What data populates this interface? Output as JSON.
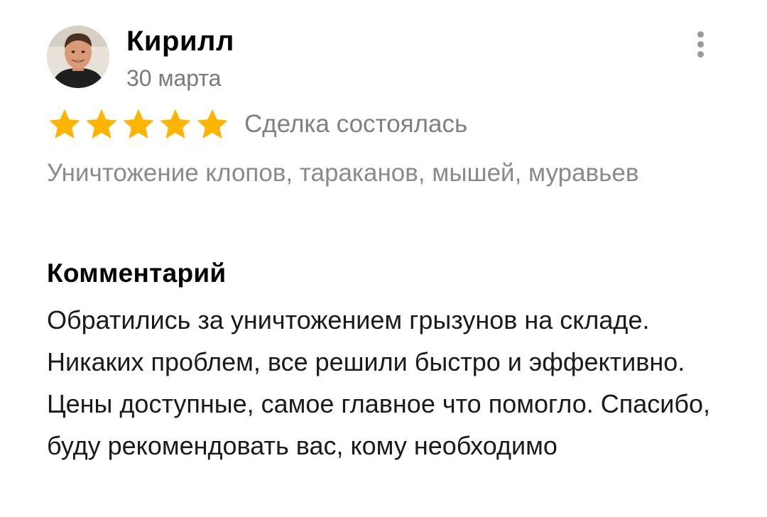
{
  "review": {
    "author": {
      "name": "Кирилл",
      "avatar_icon": "user-avatar-photo"
    },
    "date": "30 марта",
    "menu_icon": "more-vertical-icon",
    "rating": {
      "value": 5,
      "max": 5,
      "star_color": "#FFB400"
    },
    "deal_status": "Сделка состоялась",
    "service": "Уничтожение клопов, тараканов, мышей, муравьев",
    "comment_heading": "Комментарий",
    "comment": "Обратились за уничтожением грызунов на складе. Никаких проблем, все решили быстро и эффективно. Цены доступные, самое главное что помогло. Спасибо, буду рекомендовать вас, кому необходимо"
  }
}
